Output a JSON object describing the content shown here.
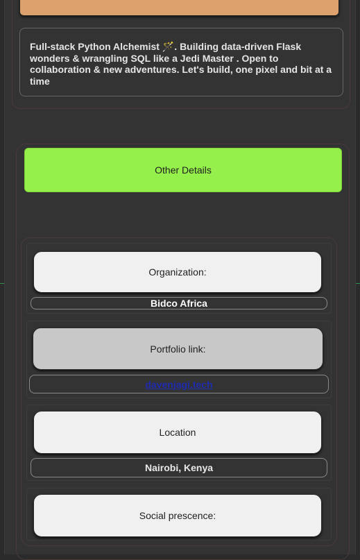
{
  "profile": {
    "bio_before_icon": "Full-stack Python Alchemist ",
    "bio_icon": "magic-wand-icon",
    "bio_after_icon": ". Building data-driven Flask wonders & wrangling SQL like a Jedi Master . Open to collaboration & new adventures. Let's build, one pixel and bit at a time"
  },
  "details": {
    "toggle_label": "Other Details",
    "fields": [
      {
        "label": "Organization:",
        "value": "Bidco Africa"
      },
      {
        "label": "Portfolio link:",
        "value": "davenjagi.tech"
      },
      {
        "label": "Location",
        "value": "Nairobi, Kenya"
      },
      {
        "label": "Social prescence:",
        "value": ""
      }
    ]
  },
  "colors": {
    "accent_green": "#95f04b",
    "accent_orange": "#dca16c",
    "background": "#333333"
  }
}
